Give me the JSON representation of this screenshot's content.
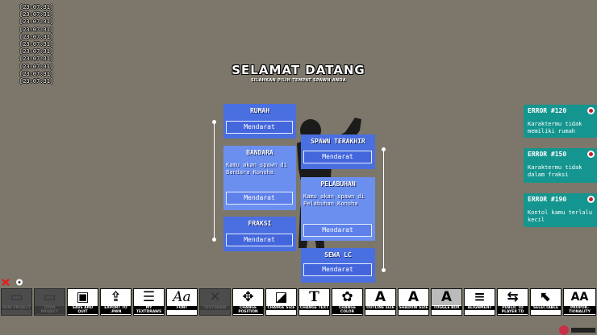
{
  "chat": [
    "[23:07:31]",
    "[23:07:31]",
    "[23:07:31]",
    "[23:07:31]",
    "[23:07:31]",
    "[23:07:31]",
    "[23:07:31]",
    "[23:07:31]",
    "[23:07:31]",
    "[23:07:31]",
    "[23:07:31]"
  ],
  "welcome": {
    "title": "SELAMAT DATANG",
    "subtitle": "SILAHKAN PILIH TEMPAT SPAWN ANDA"
  },
  "spawn": {
    "rumah": {
      "title": "RUMAH",
      "button": "Mendarat"
    },
    "bandara": {
      "title": "BANDARA",
      "desc": "Kamu akan spawn di Bandara Konoha",
      "button": "Mendarat"
    },
    "fraksi": {
      "title": "FRAKSI",
      "button": "Mendarat"
    },
    "terakhir": {
      "title": "SPAWN TERAKHIR",
      "button": "Mendarat"
    },
    "pelabuhan": {
      "title": "PELABUHAN",
      "desc": "Kamu akan spawn di Pelabuhan Konoha",
      "button": "Mendarat"
    },
    "sewa": {
      "title": "SEWA LC",
      "button": "Mendarat"
    }
  },
  "errors": [
    {
      "title": "ERROR #120",
      "text": "Karaktermu tidak memiliki rumah"
    },
    {
      "title": "ERROR #150",
      "text": "Karaktermu tidak dalam fraksi"
    },
    {
      "title": "ERROR #190",
      "text": "Kontol kamu terlalu kecil"
    }
  ],
  "toolbar": {
    "new": "NEW PROJECT",
    "open": "OPEN PROJECT",
    "save": "SAVE AND QUIT",
    "export": "EXPORT TO .PWN",
    "my": "MY TEXTDRAWS",
    "font": "FONT",
    "textdraw": "TEXTDRAW",
    "position": "CHANGE POSITION",
    "size": "CHANGE SIZE",
    "text": "CHANGE TEXT",
    "color": "CHANGE COLOR",
    "outline": "OUTLINE SIZE",
    "shadow": "SHADOW SIZE",
    "toggle": "TOGGLE BOX",
    "alignment": "ALIGNMENT",
    "public": "PUBLIC TD PLAYER TD",
    "selectable": "SELECTABLE",
    "proportionality": "PROPOR- TIONALITY"
  }
}
